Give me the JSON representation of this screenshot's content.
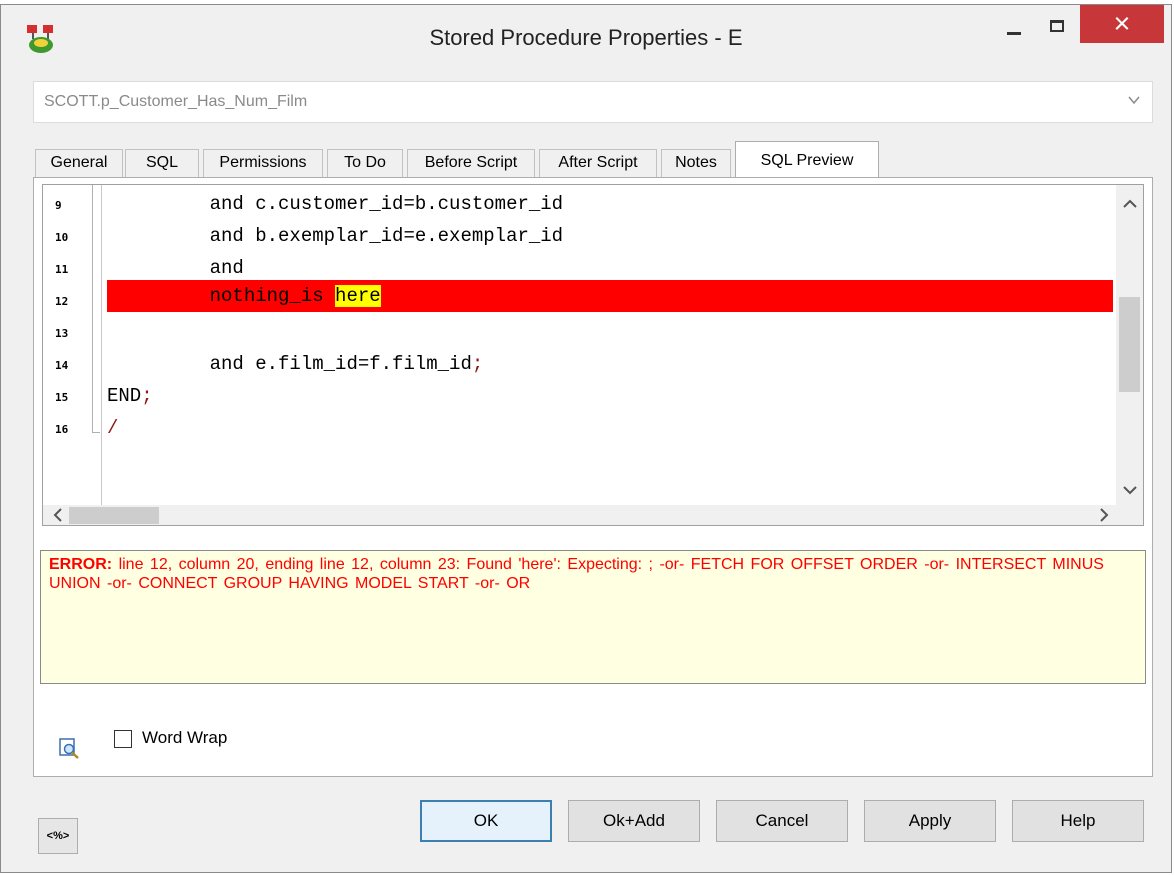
{
  "window": {
    "title": "Stored Procedure Properties - E",
    "close_symbol": "×"
  },
  "object_selector": {
    "value": "SCOTT.p_Customer_Has_Num_Film"
  },
  "tabs": [
    {
      "label": "General"
    },
    {
      "label": "SQL"
    },
    {
      "label": "Permissions"
    },
    {
      "label": "To Do"
    },
    {
      "label": "Before Script"
    },
    {
      "label": "After Script"
    },
    {
      "label": "Notes"
    },
    {
      "label": "SQL Preview",
      "active": true
    }
  ],
  "editor": {
    "lines": [
      {
        "number": "9",
        "code": "         and c.customer_id=b.customer_id"
      },
      {
        "number": "10",
        "code": "         and b.exemplar_id=e.exemplar_id"
      },
      {
        "number": "11",
        "code": "         and"
      },
      {
        "number": "12",
        "code_before": "         nothing_is ",
        "code_highlight": "here",
        "error": true
      },
      {
        "number": "13",
        "code": ""
      },
      {
        "number": "14",
        "code": "         and e.film_id=f.film_id",
        "code_punct": ";"
      },
      {
        "number": "15",
        "code": "END",
        "code_punct": ";"
      },
      {
        "number": "16",
        "code": "",
        "code_punct": "/"
      }
    ],
    "highlight_color": "#ff0000",
    "token_highlight_color": "#ffff00"
  },
  "error_panel": {
    "label": "ERROR:",
    "message": "line 12, column 20, ending line 12, column 23: Found 'here': Expecting: ;  -or-  FETCH FOR OFFSET ORDER  -or-  INTERSECT MINUS UNION  -or-  CONNECT GROUP HAVING MODEL START  -or-  OR",
    "color": "#ff0000",
    "background": "#ffffe1"
  },
  "options": {
    "word_wrap_label": "Word Wrap",
    "word_wrap_checked": false
  },
  "buttons": {
    "macro_label": "<%>",
    "ok": "OK",
    "ok_add": "Ok+Add",
    "cancel": "Cancel",
    "apply": "Apply",
    "help": "Help"
  }
}
